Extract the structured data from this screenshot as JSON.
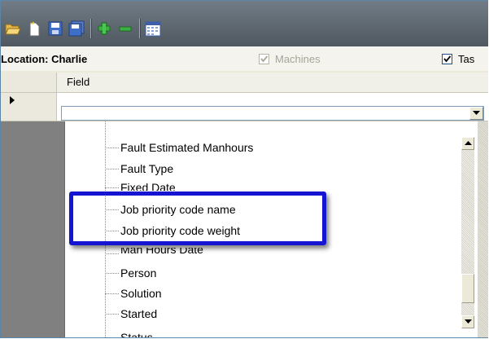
{
  "toolbar": {
    "buttons": [
      {
        "name": "open-folder-icon"
      },
      {
        "name": "new-document-icon"
      },
      {
        "name": "save-icon"
      },
      {
        "name": "save-all-icon"
      },
      {
        "name": "add-icon"
      },
      {
        "name": "remove-icon"
      },
      {
        "name": "calendar-icon"
      }
    ]
  },
  "location": {
    "label": "Location: Charlie",
    "checkbox_machines": {
      "label": "Machines",
      "checked": true,
      "enabled": false
    },
    "checkbox_tasks": {
      "label": "Tas",
      "checked": true,
      "enabled": true
    }
  },
  "grid": {
    "column_header": "Field",
    "row_indicator": "current-row-arrow",
    "combo_value": ""
  },
  "dropdown": {
    "items": [
      "Fault Estimated Manhours",
      "Fault Type",
      "Fixed Date",
      "Job priority code name",
      "Job priority code weight",
      "Man Hours Date",
      "Person",
      "Solution",
      "Started",
      "Status"
    ],
    "highlighted_items": [
      "Job priority code name",
      "Job priority code weight"
    ]
  },
  "colors": {
    "toolbar_bg": "#5a636b",
    "highlight_border": "#1414d2",
    "row_header_bg": "#ebe9dd"
  }
}
